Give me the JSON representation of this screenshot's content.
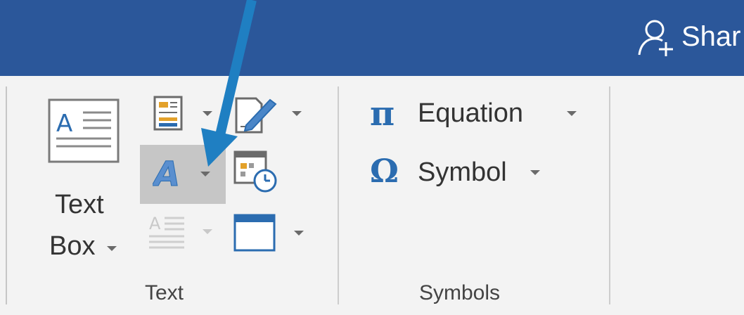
{
  "titlebar": {
    "share_label": "Shar",
    "share_icon": "person-add-icon",
    "bg_color": "#2b579a"
  },
  "ribbon": {
    "text_group": {
      "label": "Text",
      "text_box": {
        "label_line1": "Text",
        "label_line2": "Box",
        "icon": "text-box-icon"
      },
      "quick_parts": {
        "icon": "quick-parts-icon"
      },
      "signature_line": {
        "icon": "signature-line-icon"
      },
      "wordart": {
        "icon": "wordart-icon",
        "highlighted": true
      },
      "date_time": {
        "icon": "date-time-icon"
      },
      "drop_cap": {
        "icon": "drop-cap-icon",
        "disabled": true
      },
      "object": {
        "icon": "object-icon"
      }
    },
    "symbols_group": {
      "label": "Symbols",
      "equation": {
        "label": "Equation",
        "icon": "pi-icon",
        "glyph": "π"
      },
      "symbol": {
        "label": "Symbol",
        "icon": "omega-icon",
        "glyph": "Ω"
      }
    }
  },
  "annotation": {
    "icon": "arrow-icon",
    "color": "#1f7fc2"
  }
}
